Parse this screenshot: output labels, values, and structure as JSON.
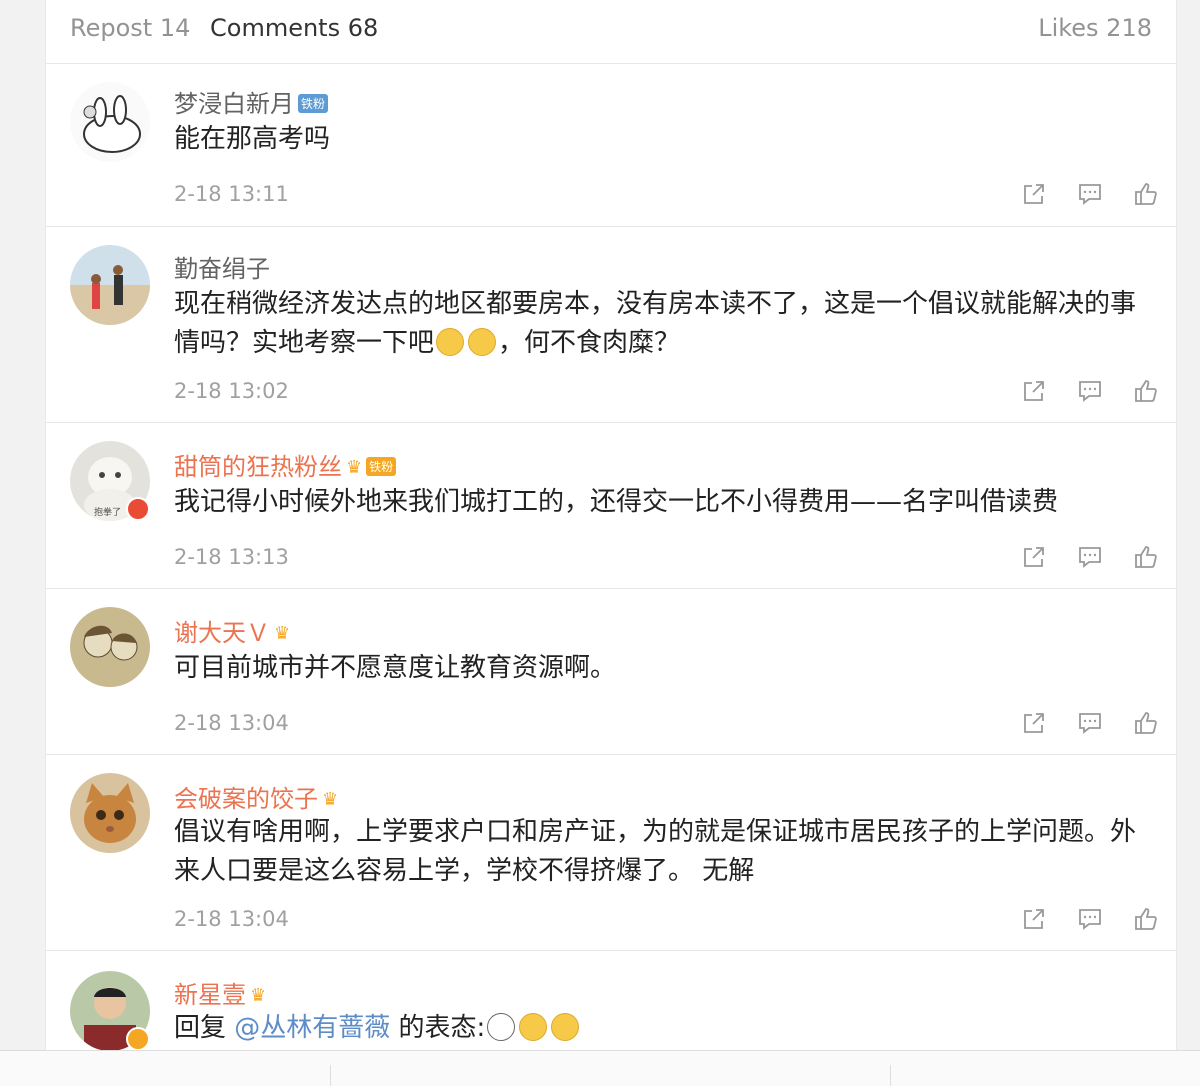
{
  "tabs": {
    "repost": "Repost 14",
    "comments": "Comments 68",
    "likes": "Likes 218"
  },
  "comments": [
    {
      "name": "梦浸白新月",
      "badge": "铁粉",
      "text": "能在那高考吗",
      "time": "2-18 13:11"
    },
    {
      "name": "勤奋绢子",
      "text": "现在稍微经济发达点的地区都要房本，没有房本读不了，这是一个倡议就能解决的事情吗？实地考察一下吧",
      "text_tail": "，何不食肉糜？",
      "time": "2-18 13:02"
    },
    {
      "name": "甜筒的狂热粉丝",
      "badge": "铁粉",
      "avatar_label": "抱拳了",
      "text": "我记得小时候外地来我们城打工的，还得交一比不小得费用——名字叫借读费",
      "time": "2-18 13:13"
    },
    {
      "name": "谢大天Ｖ",
      "text": "可目前城市并不愿意度让教育资源啊。",
      "time": "2-18 13:04"
    },
    {
      "name": "会破案的饺子",
      "text": "倡议有啥用啊，上学要求户口和房产证，为的就是保证城市居民孩子的上学问题。外来人口要是这么容易上学，学校不得挤爆了。 无解",
      "time": "2-18 13:04"
    },
    {
      "name": "新星壹",
      "reply_prefix": "回复",
      "mention": "@丛林有蔷薇",
      "reply_suffix": " 的表态:",
      "time": ""
    }
  ],
  "colors": {
    "accent": "#eb7350",
    "link": "#5d8cc7",
    "muted": "#a0a0a0"
  },
  "icons": [
    "share-icon",
    "comment-icon",
    "like-icon",
    "crown-icon",
    "verified-icon"
  ]
}
